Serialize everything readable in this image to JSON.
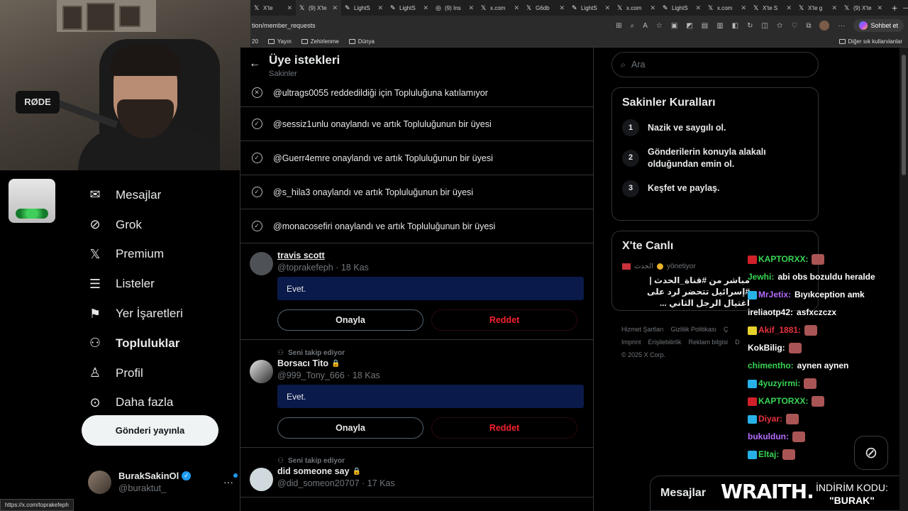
{
  "browser": {
    "tabs": [
      {
        "icon": "x-icon",
        "label": "X'te"
      },
      {
        "icon": "x-icon",
        "label": "(9) X'te"
      },
      {
        "icon": "lightshot-icon",
        "label": "LightS"
      },
      {
        "icon": "lightshot-icon",
        "label": "LightS"
      },
      {
        "icon": "instagram-icon",
        "label": "(9) Ins"
      },
      {
        "icon": "x-icon",
        "label": "x.com"
      },
      {
        "icon": "x-icon",
        "label": "G6db"
      },
      {
        "icon": "lightshot-icon",
        "label": "LightS"
      },
      {
        "icon": "x-icon",
        "label": "x.com"
      },
      {
        "icon": "lightshot-icon",
        "label": "LightS"
      },
      {
        "icon": "x-icon",
        "label": "x.com"
      },
      {
        "icon": "x-icon",
        "label": "X'te S"
      },
      {
        "icon": "x-icon",
        "label": "X'te g"
      },
      {
        "icon": "x-icon",
        "label": "(9) X'te"
      }
    ],
    "url": "tion/member_requests",
    "chat_button": "Sohbet et",
    "bookmarks": [
      "Yayın",
      "Zehirlenme",
      "Dünya"
    ],
    "bookmarks_prefix": "20",
    "bookmarks_other": "Diğer sık kullanılanlar",
    "status_url": "https://x.com/toprakefeph"
  },
  "nav": {
    "items": [
      {
        "icon": "mail-icon",
        "label": "Mesajlar"
      },
      {
        "icon": "grok-icon",
        "label": "Grok"
      },
      {
        "icon": "x-logo-icon",
        "label": "Premium"
      },
      {
        "icon": "list-icon",
        "label": "Listeler"
      },
      {
        "icon": "bookmark-icon",
        "label": "Yer İşaretleri"
      },
      {
        "icon": "communities-icon",
        "label": "Topluluklar"
      },
      {
        "icon": "person-icon",
        "label": "Profil"
      },
      {
        "icon": "more-circle-icon",
        "label": "Daha fazla"
      }
    ],
    "post_button": "Gönderi yayınla",
    "profile": {
      "name": "BurakSakinOl",
      "handle": "@buraktut_"
    }
  },
  "main": {
    "title": "Üye istekleri",
    "subtitle": "Sakinler",
    "notices": [
      {
        "status": "rejected",
        "text": "@ultrags0055 reddedildiği için Topluluğuna katılamıyor"
      },
      {
        "status": "approved",
        "text": "@sessiz1unlu onaylandı ve artık Topluluğunun bir üyesi"
      },
      {
        "status": "approved",
        "text": "@Guerr4emre onaylandı ve artık Topluluğunun bir üyesi"
      },
      {
        "status": "approved",
        "text": "@s_hila3 onaylandı ve artık Topluluğunun bir üyesi"
      },
      {
        "status": "approved",
        "text": "@monacosefiri onaylandı ve artık Topluluğunun bir üyesi"
      }
    ],
    "requests": [
      {
        "follows_label": "",
        "name": "travis scott",
        "handle": "@toprakefeph",
        "date": "18 Kas",
        "answer": "Evet.",
        "locked": false
      },
      {
        "follows_label": "Seni takip ediyor",
        "name": "Borsacı Tito",
        "handle": "@999_Tony_666",
        "date": "18 Kas",
        "answer": "Evet.",
        "locked": true
      },
      {
        "follows_label": "Seni takip ediyor",
        "name": "did someone say",
        "handle": "@did_someon20707",
        "date": "17 Kas",
        "answer": "",
        "locked": true
      }
    ],
    "approve_label": "Onayla",
    "reject_label": "Reddet",
    "meta_separator": "·"
  },
  "sidebar": {
    "search_placeholder": "Ara",
    "rules_title": "Sakinler Kuralları",
    "rules": [
      {
        "num": "1",
        "text": "Nazik ve saygılı ol."
      },
      {
        "num": "2",
        "text": "Gönderilerin konuyla alakalı olduğundan emin ol."
      },
      {
        "num": "3",
        "text": "Keşfet ve paylaş."
      }
    ],
    "live_title": "X'te Canlı",
    "live_host": "الحدث",
    "live_host_role": "yönetiyor",
    "live_text": "مباشر من #قناة_الحدث | #إسرائيل تتحضر لرد على اغتيال الرجل الثاني ...",
    "footer": [
      "Hizmet Şartları",
      "Gizlilik Politikası",
      "Ç",
      "Imprint",
      "Erişilebilirlik",
      "Reklam bilgisi",
      "D",
      "© 2025 X Corp."
    ]
  },
  "overlay": {
    "chat": [
      {
        "badge_color": "#d0202a",
        "user": "KAPTORXX:",
        "user_color": "#39d353",
        "msg": ""
      },
      {
        "badge_color": "",
        "user": "Jewhi:",
        "user_color": "#39d353",
        "msg": "abi obs bozuldu heralde"
      },
      {
        "badge_color": "#27b1e6",
        "user": "MrJetix:",
        "user_color": "#b36bff",
        "msg": "Bıyıkception amk"
      },
      {
        "badge_color": "",
        "user": "ireliaotp42:",
        "user_color": "#ffffff",
        "msg": "asfxczczx"
      },
      {
        "badge_color": "#e6d12a",
        "user": "Akif_1881:",
        "user_color": "#e6323e",
        "msg": ""
      },
      {
        "badge_color": "",
        "user": "KokBilig:",
        "user_color": "#ffffff",
        "msg": ""
      },
      {
        "badge_color": "",
        "user": "chimentho:",
        "user_color": "#39d353",
        "msg": "aynen aynen"
      },
      {
        "badge_color": "#27b1e6",
        "user": "4yuzyirmi:",
        "user_color": "#39d353",
        "msg": ""
      },
      {
        "badge_color": "#d0202a",
        "user": "KAPTORXX:",
        "user_color": "#39d353",
        "msg": ""
      },
      {
        "badge_color": "#27b1e6",
        "user": "Diyar:",
        "user_color": "#e6323e",
        "msg": ""
      },
      {
        "badge_color": "",
        "user": "bukuldun:",
        "user_color": "#b36bff",
        "msg": ""
      },
      {
        "badge_color": "#27b1e6",
        "user": "Eltaj:",
        "user_color": "#39d353",
        "msg": ""
      }
    ],
    "messages_dock": "Mesajlar",
    "brand": "WRAITH.",
    "promo_label": "İNDİRİM KODU:",
    "promo_code": "\"BURAK\"",
    "mic_brand": "RØDE"
  },
  "colors": {
    "background": "#000000",
    "accent": "#1d9bf0",
    "reject": "#f4212e",
    "answer_bg": "#0a1a4a",
    "border": "#2f3336"
  }
}
